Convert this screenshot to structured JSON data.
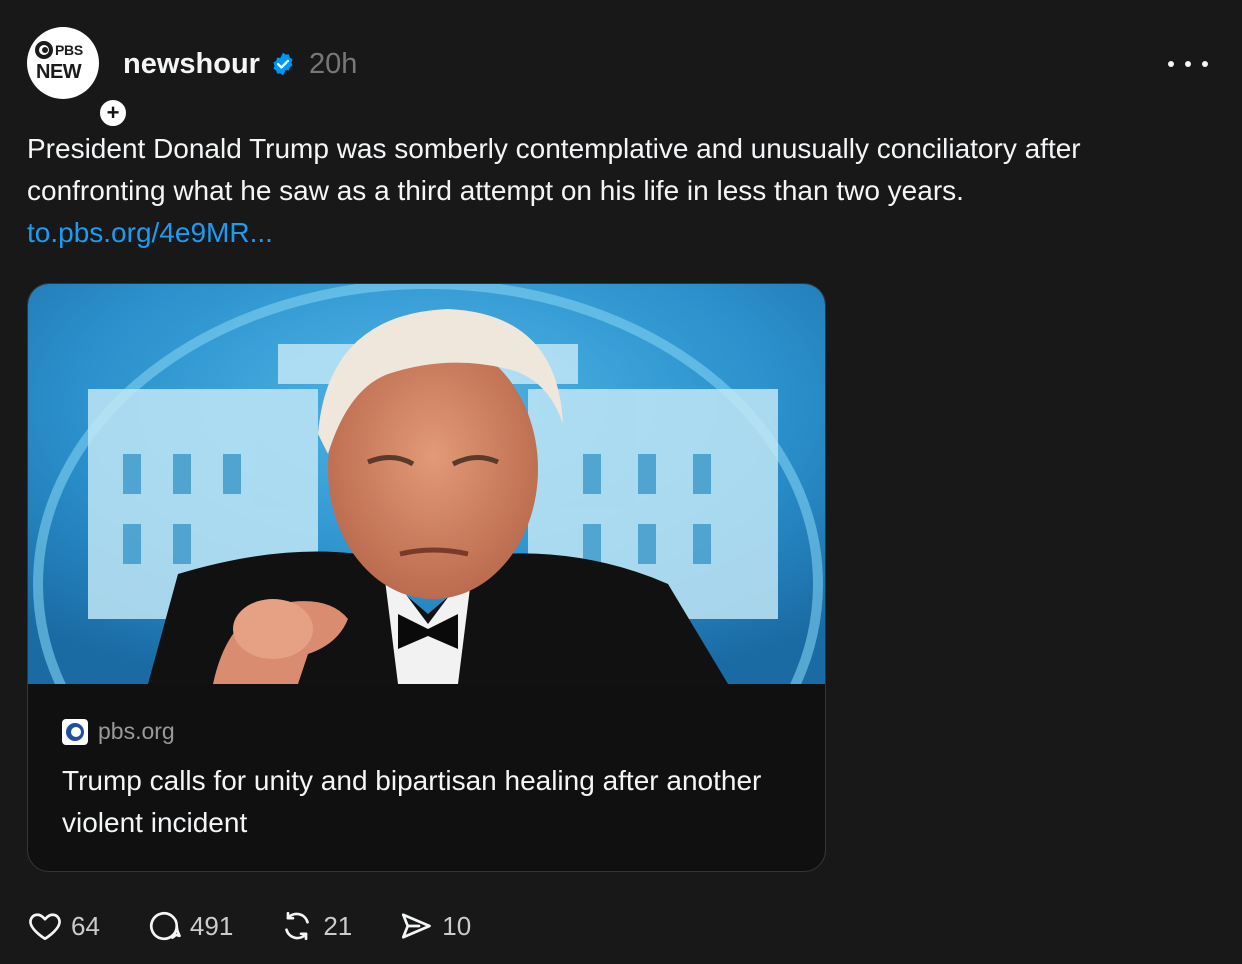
{
  "post": {
    "avatar": {
      "brand": "PBS",
      "line2": "NEW"
    },
    "follow_symbol": "+",
    "username": "newshour",
    "verified": true,
    "time": "20h",
    "text": "President Donald Trump was somberly contemplative and unusually conciliatory after confronting what he saw as a third attempt on his life in less than two years.",
    "link": "to.pbs.org/4e9MR...",
    "card": {
      "image_icon": "trump-photo",
      "domain": "pbs.org",
      "title": "Trump calls for unity and bipartisan healing after another violent incident"
    },
    "actions": {
      "likes": "64",
      "replies": "491",
      "reposts": "21",
      "shares": "10"
    }
  },
  "colors": {
    "background": "#181818",
    "text": "#f3f5f7",
    "link": "#1d9bf0",
    "verified": "#0095f6",
    "muted": "#777777"
  }
}
